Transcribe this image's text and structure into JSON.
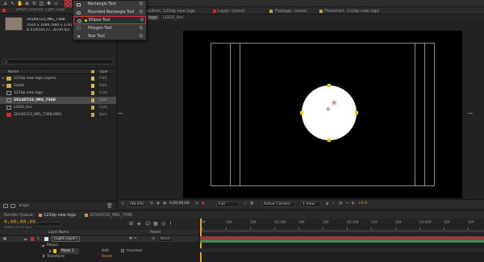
{
  "menu": {
    "items": [
      {
        "label": "Rectangle Tool",
        "shortcut": "Q",
        "icon": "rectangle-icon"
      },
      {
        "label": "Rounded Rectangle Tool",
        "shortcut": "Q",
        "icon": "rounded-rectangle-icon"
      },
      {
        "label": "Ellipse Tool",
        "shortcut": "Q",
        "icon": "ellipse-icon",
        "active": true
      },
      {
        "label": "Polygon Tool",
        "shortcut": "Q",
        "icon": "polygon-icon"
      },
      {
        "label": "Star Tool",
        "shortcut": "Q",
        "icon": "star-icon"
      }
    ]
  },
  "comp_tabs": {
    "composition": "osition: 122dp new logo",
    "layer": "Layer: (none)",
    "footage": "Footage: (none)",
    "flowchart": "Flowchart: 122dp new logo"
  },
  "comp_sub": {
    "tab1": "logo",
    "tab2": "LOGO_Ani"
  },
  "project": {
    "tab": "Effect Controls: Light Layer",
    "meta_name": "20140723_IMG_7368",
    "meta_size": "1920 x 1080 (480 x 270)",
    "meta_dur": "Δ 0;00;04;27, 30.00 fps",
    "search_placeholder": "ρ",
    "col_name": "Name",
    "col_type": "Type",
    "rows": [
      {
        "name": "122dp new logo Layers",
        "type": "Fold",
        "kind": "folder",
        "label": "#e0c040"
      },
      {
        "name": "Solids",
        "type": "Fold",
        "kind": "folder",
        "label": "#e0c040"
      },
      {
        "name": "122dp new logo",
        "type": "Com",
        "kind": "comp",
        "label": "#c8a860"
      },
      {
        "name": "20140723_IMG_7368",
        "type": "Com",
        "kind": "comp",
        "label": "#c8a860",
        "selected": true
      },
      {
        "name": "LOGO_Ani",
        "type": "Com",
        "kind": "comp",
        "label": "#c8a860"
      },
      {
        "name": "20140723_IMG_7368.MOV",
        "type": "Quic",
        "kind": "movie",
        "label": "#c8a860"
      }
    ],
    "footer_bpc": "8 bpc"
  },
  "comp_footer": {
    "zoom": "(94.9%)",
    "timecode": "0;00;00;00",
    "resolution": "Full",
    "camera": "Active Camera",
    "view": "1 View",
    "exposure": "+0.0"
  },
  "timeline": {
    "tab1": "Render Queue",
    "tab2": "122dp new logo",
    "tab3": "20140723_IMG_7368",
    "timecode": "0;00;00;00",
    "frame": "00000 (29.97 fps)",
    "col_layer": "Layer Name",
    "col_parent": "Parent",
    "ruler": [
      "0f",
      "10f",
      "20f",
      "01:00f",
      "10f",
      "20f",
      "02:00f",
      "10f",
      "20f",
      "03:00f",
      "10f",
      "20f"
    ],
    "layer1_num": "1",
    "layer1_name": "[Light Layer]",
    "layer1_parent": "None",
    "masks_label": "Masks",
    "mask1_name": "Mask 1",
    "mask1_mode": "Add",
    "mask1_inverted": "Inverted",
    "transform_label": "Transform",
    "transform_value": "Reset"
  },
  "colors": {
    "accent_red": "#e03030",
    "handle_yellow": "#f0c800",
    "layer_bar_green": "#3f8a52",
    "layer_bar_red": "#9a3a3a"
  }
}
